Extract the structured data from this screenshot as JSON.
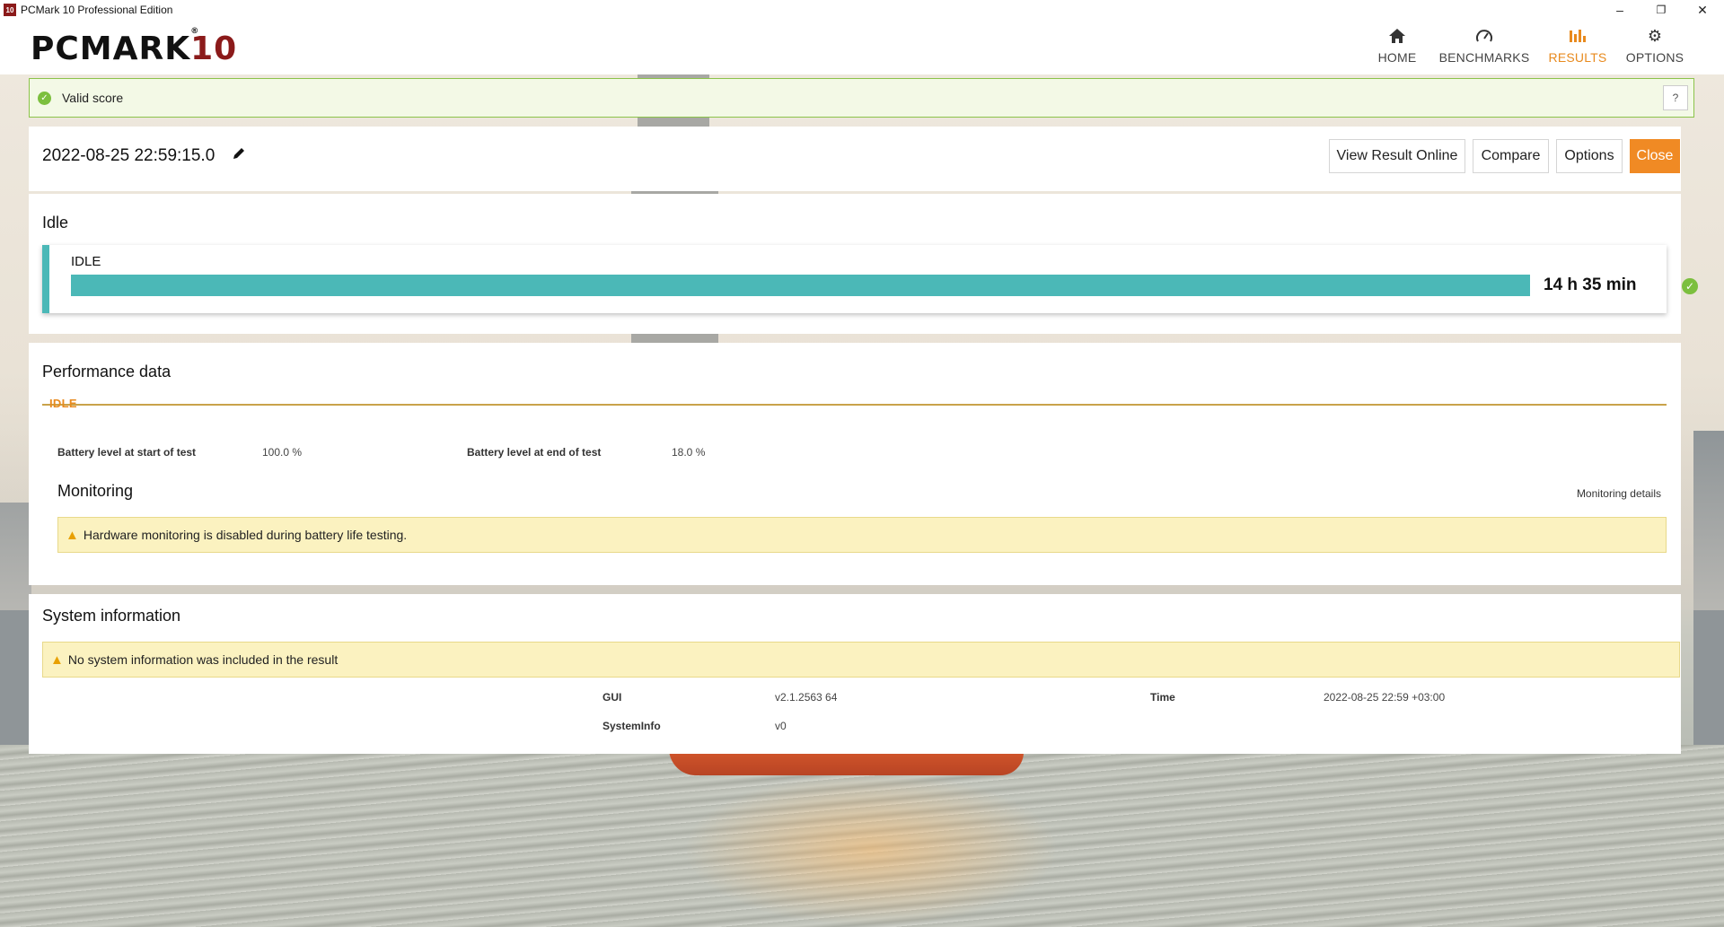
{
  "window": {
    "title": "PCMark 10 Professional Edition",
    "app_icon": "10",
    "controls": {
      "minimize": "–",
      "maximize": "❐",
      "close": "✕"
    }
  },
  "logo": {
    "main": "PCMARK",
    "number": "10",
    "reg": "®"
  },
  "nav": {
    "items": [
      {
        "label": "HOME",
        "icon": "home-icon",
        "glyph": "⌂"
      },
      {
        "label": "BENCHMARKS",
        "icon": "gauge-icon",
        "glyph": "◠"
      },
      {
        "label": "RESULTS",
        "icon": "bar-chart-icon",
        "glyph": "▮▮▮"
      },
      {
        "label": "OPTIONS",
        "icon": "gear-icon",
        "glyph": "⚙"
      }
    ],
    "active": "RESULTS",
    "accent_color": "#e88a1e"
  },
  "validity": {
    "text": "Valid score",
    "help": "?",
    "color": "#7cbf3e"
  },
  "result": {
    "timestamp": "2022-08-25 22:59:15.0",
    "buttons": {
      "view_online": "View Result Online",
      "compare": "Compare",
      "options": "Options",
      "close": "Close"
    },
    "close_color": "#f08a24"
  },
  "idle": {
    "section_title": "Idle",
    "card_label": "IDLE",
    "value": "14 h 35 min",
    "bar_fill_percent": 100,
    "bar_color": "#4bb8b7"
  },
  "performance": {
    "section_title": "Performance data",
    "tab": "IDLE",
    "battery_start_label": "Battery level at start of test",
    "battery_start_value": "100.0 %",
    "battery_end_label": "Battery level at end of test",
    "battery_end_value": "18.0 %",
    "monitoring_title": "Monitoring",
    "monitoring_link": "Monitoring details",
    "monitoring_warning": "Hardware monitoring is disabled during battery life testing."
  },
  "system": {
    "section_title": "System information",
    "warning": "No system information was included in the result",
    "rows": [
      {
        "label": "GUI",
        "value": "v2.1.2563 64"
      },
      {
        "label": "SystemInfo",
        "value": "v0"
      },
      {
        "label": "Time",
        "value": "2022-08-25 22:59 +03:00"
      }
    ]
  }
}
